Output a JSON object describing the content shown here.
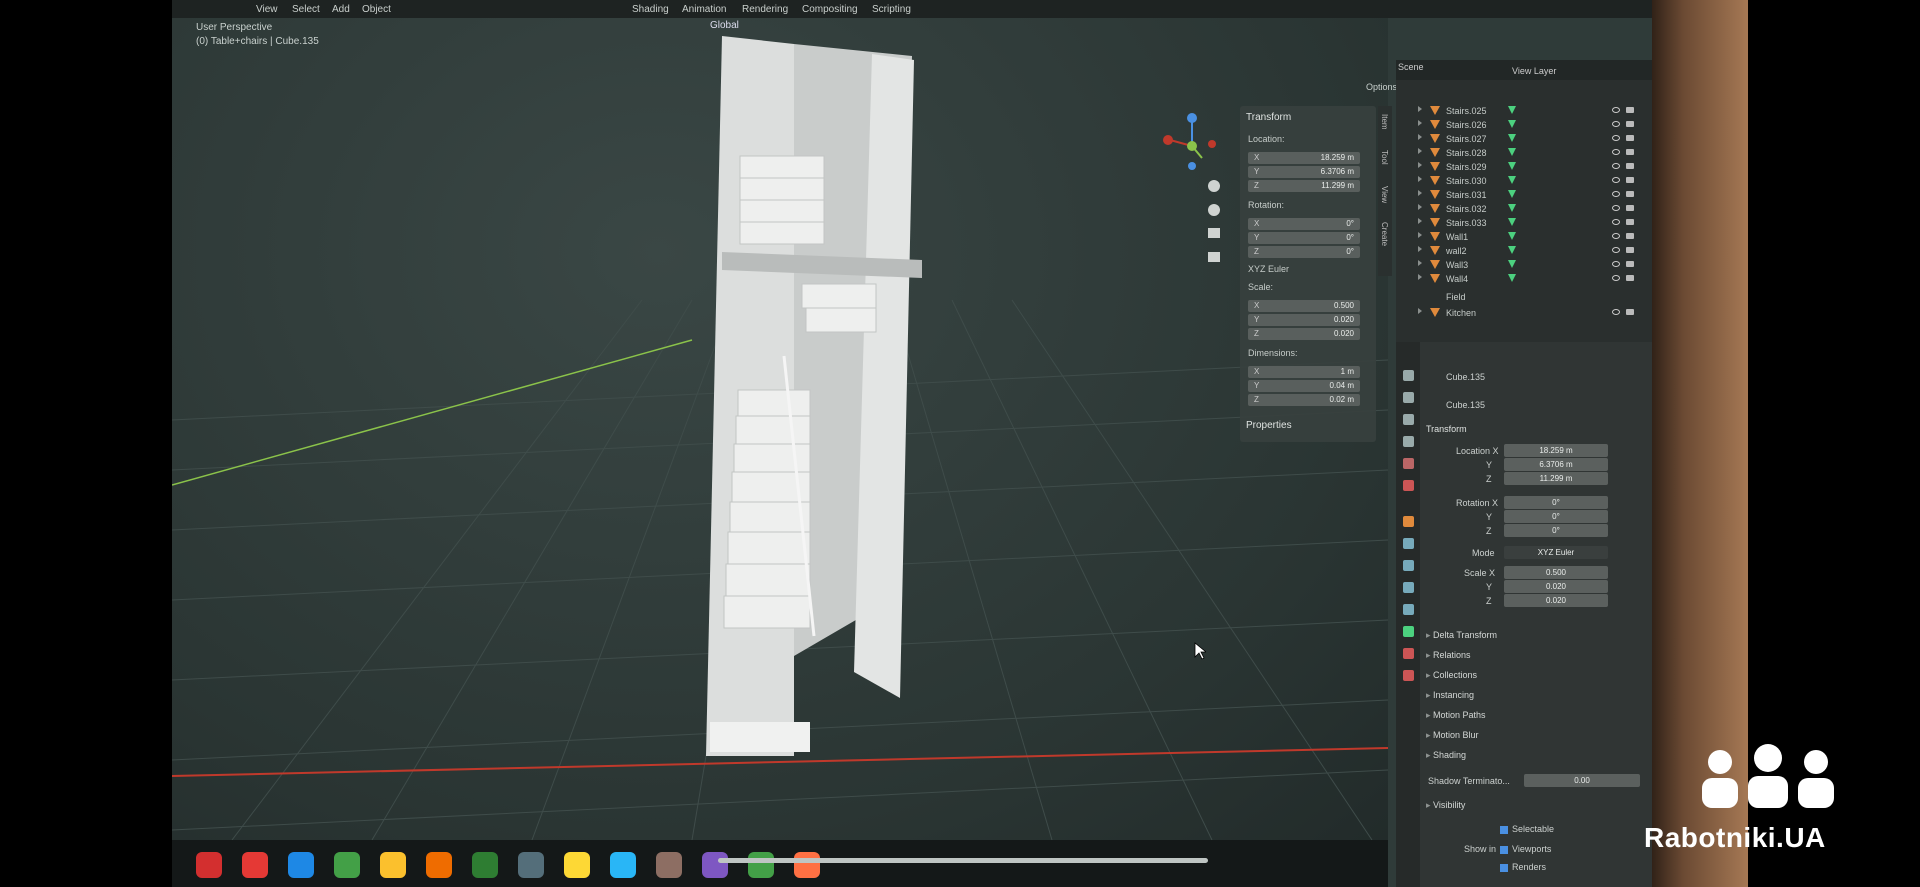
{
  "app": {
    "menu": [
      "View",
      "Select",
      "Add",
      "Object"
    ],
    "workspaces": [
      "Shading",
      "Animation",
      "Rendering",
      "Compositing",
      "Scripting"
    ],
    "transform_orientation": "Global"
  },
  "viewport": {
    "perspective_label": "User Perspective",
    "context_label": "(0) Table+chairs | Cube.135"
  },
  "n_panel": {
    "tabs": [
      "Item",
      "Tool",
      "View",
      "Create"
    ],
    "options_label": "Options",
    "transform_title": "Transform",
    "location_label": "Location:",
    "location": [
      {
        "axis": "X",
        "value": "18.259 m"
      },
      {
        "axis": "Y",
        "value": "6.3706 m"
      },
      {
        "axis": "Z",
        "value": "11.299 m"
      }
    ],
    "rotation_label": "Rotation:",
    "rotation": [
      {
        "axis": "X",
        "value": "0°"
      },
      {
        "axis": "Y",
        "value": "0°"
      },
      {
        "axis": "Z",
        "value": "0°"
      }
    ],
    "rotation_mode": "XYZ Euler",
    "scale_label": "Scale:",
    "scale": [
      {
        "axis": "X",
        "value": "0.500"
      },
      {
        "axis": "Y",
        "value": "0.020"
      },
      {
        "axis": "Z",
        "value": "0.020"
      }
    ],
    "dimensions_label": "Dimensions:",
    "dimensions": [
      {
        "axis": "X",
        "value": "1 m"
      },
      {
        "axis": "Y",
        "value": "0.04 m"
      },
      {
        "axis": "Z",
        "value": "0.02 m"
      }
    ],
    "properties_label": "Properties"
  },
  "outliner": {
    "scene_label": "Scene",
    "view_layer_label": "View Layer",
    "rows": [
      "Stairs.025",
      "Stairs.026",
      "Stairs.027",
      "Stairs.028",
      "Stairs.029",
      "Stairs.030",
      "Stairs.031",
      "Stairs.032",
      "Stairs.033",
      "Wall1",
      "wall2",
      "Wall3",
      "Wall4",
      "Field",
      "Kitchen"
    ]
  },
  "properties": {
    "object_name": "Cube.135",
    "data_name": "Cube.135",
    "transform_title": "Transform",
    "location_x_label": "Location X",
    "y_label": "Y",
    "z_label": "Z",
    "location": [
      "18.259 m",
      "6.3706 m",
      "11.299 m"
    ],
    "rotation_x_label": "Rotation X",
    "rotation": [
      "0°",
      "0°",
      "0°"
    ],
    "mode_label": "Mode",
    "mode_value": "XYZ Euler",
    "scale_x_label": "Scale X",
    "scale": [
      "0.500",
      "0.020",
      "0.020"
    ],
    "sections": [
      "Delta Transform",
      "Relations",
      "Collections",
      "Instancing",
      "Motion Paths",
      "Motion Blur",
      "Shading"
    ],
    "shadow_label": "Shadow Terminato...",
    "shadow_value": "0.00",
    "visibility_title": "Visibility",
    "selectable_label": "Selectable",
    "show_in_label": "Show in",
    "viewports_label": "Viewports",
    "renders_label": "Renders"
  },
  "taskbar": {
    "icons": [
      "opera-icon",
      "app-red-icon",
      "folder-icon",
      "chrome-icon",
      "chrome-icon",
      "blender-icon",
      "xbox-icon",
      "3d-app-icon",
      "lightbulb-icon",
      "globe-icon",
      "app-icon",
      "viber-icon",
      "media-player-icon",
      "game-icon"
    ]
  },
  "watermark": {
    "text": "Rabotniki.UA"
  },
  "colors": {
    "viewport_bg": "#2f3b39",
    "object_orange": "#e08a3c",
    "mesh_green": "#4cd17f",
    "x_axis_red": "#c0392b",
    "y_axis_green": "#8bc34a"
  }
}
